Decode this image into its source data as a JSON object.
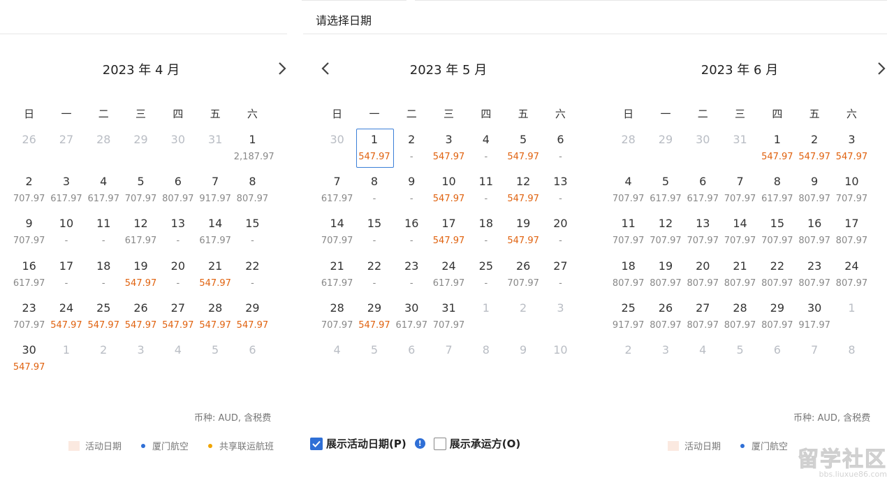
{
  "header": {
    "title": "请选择日期"
  },
  "weekdays": [
    "日",
    "一",
    "二",
    "三",
    "四",
    "五",
    "六"
  ],
  "colors": {
    "low_price": "#e0620f",
    "normal_price": "#888888",
    "selected_border": "#3b7fd8",
    "accent": "#2f6fd6"
  },
  "months": [
    {
      "title": "2023 年 4 月",
      "nav": "next",
      "days": [
        {
          "d": "26",
          "p": "",
          "o": true
        },
        {
          "d": "27",
          "p": "",
          "o": true
        },
        {
          "d": "28",
          "p": "",
          "o": true
        },
        {
          "d": "29",
          "p": "",
          "o": true
        },
        {
          "d": "30",
          "p": "",
          "o": true
        },
        {
          "d": "31",
          "p": "",
          "o": true
        },
        {
          "d": "1",
          "p": "2,187.97"
        },
        {
          "d": "2",
          "p": "707.97"
        },
        {
          "d": "3",
          "p": "617.97"
        },
        {
          "d": "4",
          "p": "617.97"
        },
        {
          "d": "5",
          "p": "707.97"
        },
        {
          "d": "6",
          "p": "807.97"
        },
        {
          "d": "7",
          "p": "917.97"
        },
        {
          "d": "8",
          "p": "807.97"
        },
        {
          "d": "9",
          "p": "707.97"
        },
        {
          "d": "10",
          "p": "-"
        },
        {
          "d": "11",
          "p": "-"
        },
        {
          "d": "12",
          "p": "617.97"
        },
        {
          "d": "13",
          "p": "-"
        },
        {
          "d": "14",
          "p": "617.97"
        },
        {
          "d": "15",
          "p": "-"
        },
        {
          "d": "16",
          "p": "617.97"
        },
        {
          "d": "17",
          "p": "-"
        },
        {
          "d": "18",
          "p": "-"
        },
        {
          "d": "19",
          "p": "547.97",
          "low": true
        },
        {
          "d": "20",
          "p": "-"
        },
        {
          "d": "21",
          "p": "547.97",
          "low": true
        },
        {
          "d": "22",
          "p": "-"
        },
        {
          "d": "23",
          "p": "707.97"
        },
        {
          "d": "24",
          "p": "547.97",
          "low": true
        },
        {
          "d": "25",
          "p": "547.97",
          "low": true
        },
        {
          "d": "26",
          "p": "547.97",
          "low": true
        },
        {
          "d": "27",
          "p": "547.97",
          "low": true
        },
        {
          "d": "28",
          "p": "547.97",
          "low": true
        },
        {
          "d": "29",
          "p": "547.97",
          "low": true
        },
        {
          "d": "30",
          "p": "547.97",
          "low": true
        },
        {
          "d": "1",
          "p": "",
          "o": true
        },
        {
          "d": "2",
          "p": "",
          "o": true
        },
        {
          "d": "3",
          "p": "",
          "o": true
        },
        {
          "d": "4",
          "p": "",
          "o": true
        },
        {
          "d": "5",
          "p": "",
          "o": true
        },
        {
          "d": "6",
          "p": "",
          "o": true
        }
      ],
      "currency": "币种: AUD, 含税费",
      "legend": [
        "活动日期",
        "厦门航空",
        "共享联运航班"
      ]
    },
    {
      "title": "2023 年 5 月",
      "nav": "prev",
      "days": [
        {
          "d": "30",
          "p": "",
          "o": true
        },
        {
          "d": "1",
          "p": "547.97",
          "low": true,
          "sel": true
        },
        {
          "d": "2",
          "p": "-"
        },
        {
          "d": "3",
          "p": "547.97",
          "low": true
        },
        {
          "d": "4",
          "p": "-"
        },
        {
          "d": "5",
          "p": "547.97",
          "low": true
        },
        {
          "d": "6",
          "p": "-"
        },
        {
          "d": "7",
          "p": "617.97"
        },
        {
          "d": "8",
          "p": "-"
        },
        {
          "d": "9",
          "p": "-"
        },
        {
          "d": "10",
          "p": "547.97",
          "low": true
        },
        {
          "d": "11",
          "p": "-"
        },
        {
          "d": "12",
          "p": "547.97",
          "low": true
        },
        {
          "d": "13",
          "p": "-"
        },
        {
          "d": "14",
          "p": "707.97"
        },
        {
          "d": "15",
          "p": "-"
        },
        {
          "d": "16",
          "p": "-"
        },
        {
          "d": "17",
          "p": "547.97",
          "low": true
        },
        {
          "d": "18",
          "p": "-"
        },
        {
          "d": "19",
          "p": "547.97",
          "low": true
        },
        {
          "d": "20",
          "p": "-"
        },
        {
          "d": "21",
          "p": "617.97"
        },
        {
          "d": "22",
          "p": "-"
        },
        {
          "d": "23",
          "p": "-"
        },
        {
          "d": "24",
          "p": "617.97"
        },
        {
          "d": "25",
          "p": "-"
        },
        {
          "d": "26",
          "p": "707.97"
        },
        {
          "d": "27",
          "p": "-"
        },
        {
          "d": "28",
          "p": "707.97"
        },
        {
          "d": "29",
          "p": "547.97",
          "low": true
        },
        {
          "d": "30",
          "p": "617.97"
        },
        {
          "d": "31",
          "p": "707.97"
        },
        {
          "d": "1",
          "p": "",
          "o": true
        },
        {
          "d": "2",
          "p": "",
          "o": true
        },
        {
          "d": "3",
          "p": "",
          "o": true
        },
        {
          "d": "4",
          "p": "",
          "o": true
        },
        {
          "d": "5",
          "p": "",
          "o": true
        },
        {
          "d": "6",
          "p": "",
          "o": true
        },
        {
          "d": "7",
          "p": "",
          "o": true
        },
        {
          "d": "8",
          "p": "",
          "o": true
        },
        {
          "d": "9",
          "p": "",
          "o": true
        },
        {
          "d": "10",
          "p": "",
          "o": true
        }
      ]
    },
    {
      "title": "2023 年 6 月",
      "nav": "next",
      "days": [
        {
          "d": "28",
          "p": "",
          "o": true
        },
        {
          "d": "29",
          "p": "",
          "o": true
        },
        {
          "d": "30",
          "p": "",
          "o": true
        },
        {
          "d": "31",
          "p": "",
          "o": true
        },
        {
          "d": "1",
          "p": "547.97",
          "low": true
        },
        {
          "d": "2",
          "p": "547.97",
          "low": true
        },
        {
          "d": "3",
          "p": "547.97",
          "low": true
        },
        {
          "d": "4",
          "p": "707.97"
        },
        {
          "d": "5",
          "p": "617.97"
        },
        {
          "d": "6",
          "p": "617.97"
        },
        {
          "d": "7",
          "p": "707.97"
        },
        {
          "d": "8",
          "p": "617.97"
        },
        {
          "d": "9",
          "p": "807.97"
        },
        {
          "d": "10",
          "p": "707.97"
        },
        {
          "d": "11",
          "p": "707.97"
        },
        {
          "d": "12",
          "p": "707.97"
        },
        {
          "d": "13",
          "p": "707.97"
        },
        {
          "d": "14",
          "p": "707.97"
        },
        {
          "d": "15",
          "p": "707.97"
        },
        {
          "d": "16",
          "p": "807.97"
        },
        {
          "d": "17",
          "p": "807.97"
        },
        {
          "d": "18",
          "p": "807.97"
        },
        {
          "d": "19",
          "p": "807.97"
        },
        {
          "d": "20",
          "p": "807.97"
        },
        {
          "d": "21",
          "p": "807.97"
        },
        {
          "d": "22",
          "p": "807.97"
        },
        {
          "d": "23",
          "p": "807.97"
        },
        {
          "d": "24",
          "p": "807.97"
        },
        {
          "d": "25",
          "p": "917.97"
        },
        {
          "d": "26",
          "p": "807.97"
        },
        {
          "d": "27",
          "p": "807.97"
        },
        {
          "d": "28",
          "p": "807.97"
        },
        {
          "d": "29",
          "p": "807.97"
        },
        {
          "d": "30",
          "p": "917.97"
        },
        {
          "d": "1",
          "p": "",
          "o": true
        },
        {
          "d": "2",
          "p": "",
          "o": true
        },
        {
          "d": "3",
          "p": "",
          "o": true
        },
        {
          "d": "4",
          "p": "",
          "o": true
        },
        {
          "d": "5",
          "p": "",
          "o": true
        },
        {
          "d": "6",
          "p": "",
          "o": true
        },
        {
          "d": "7",
          "p": "",
          "o": true
        },
        {
          "d": "8",
          "p": "",
          "o": true
        }
      ],
      "currency": "币种: AUD, 含税费",
      "legend": [
        "活动日期",
        "厦门航空"
      ]
    }
  ],
  "options": {
    "show_activity_label": "展示活动日期(P)",
    "show_activity_checked": true,
    "show_carrier_label": "展示承运方(O)",
    "show_carrier_checked": false,
    "info_icon": "info-icon"
  },
  "legend_colors": {
    "activity": "#fbe9e0",
    "xiamen": "#2f6fd6",
    "codeshare": "#f0a400"
  },
  "watermark": {
    "text": "留学社区",
    "url": "bbs.liuxue86.com"
  }
}
